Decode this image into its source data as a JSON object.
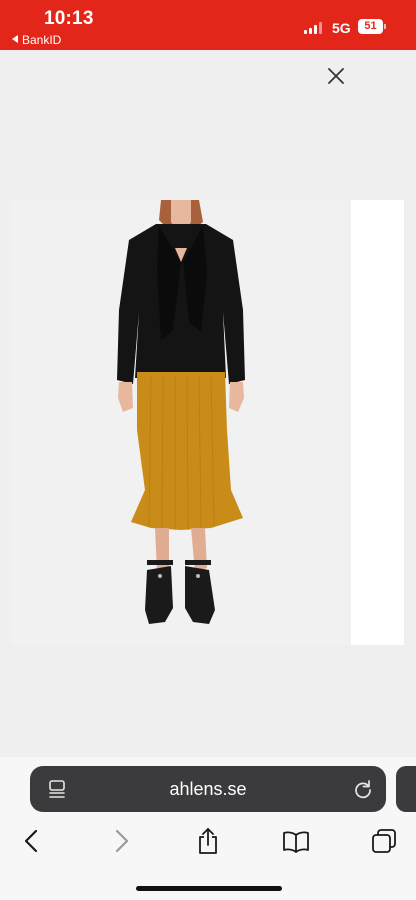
{
  "status_bar": {
    "time": "10:13",
    "back_app_label": "BankID",
    "network": "5G",
    "battery": "51",
    "background": "#e3261a"
  },
  "overlay": {
    "close_icon": "close-icon"
  },
  "product": {
    "image_alt": "product photo",
    "top_color": "#141414",
    "skirt_color": "#c98c19",
    "shoe_color": "#1a1a1a"
  },
  "browser": {
    "url": "ahlens.se",
    "address_bar_color": "#3b3b3d",
    "icons": [
      "page-settings-icon",
      "reload-icon",
      "back-icon",
      "forward-icon",
      "share-icon",
      "bookmarks-icon",
      "tabs-icon"
    ]
  }
}
